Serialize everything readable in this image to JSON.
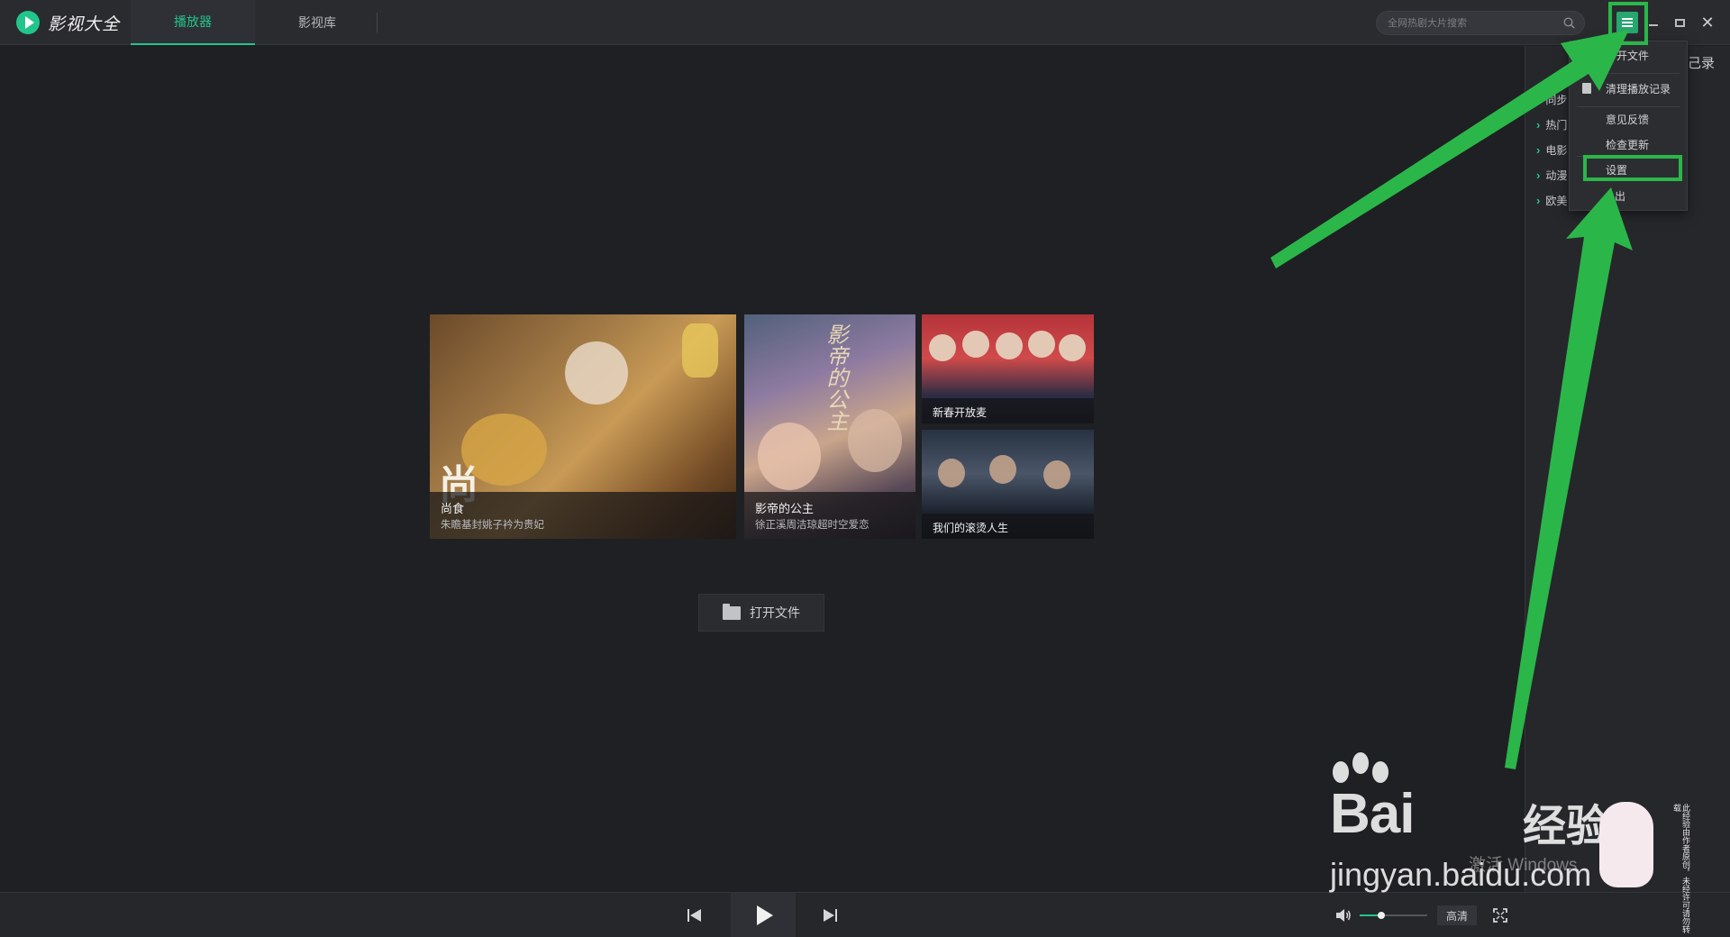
{
  "app": {
    "name": "影视大全",
    "tabs": [
      {
        "label": "播放器",
        "active": true
      },
      {
        "label": "影视库",
        "active": false
      }
    ],
    "search_placeholder": "全网热剧大片搜索"
  },
  "window_controls": {
    "menu": "menu-icon",
    "minimize": "minimize-icon",
    "maximize": "maximize-icon",
    "close": "✕"
  },
  "dropdown_menu": {
    "items": [
      {
        "label": "打开文件"
      },
      {
        "label": "清理播放记录"
      },
      {
        "label": "意见反馈"
      },
      {
        "label": "检查更新"
      },
      {
        "label": "设置"
      },
      {
        "label": "出"
      }
    ]
  },
  "right_panel": {
    "record_label": "己录",
    "categories": [
      {
        "label": "同步"
      },
      {
        "label": "热门"
      },
      {
        "label": "电影"
      },
      {
        "label": "动漫"
      },
      {
        "label": "欧美"
      }
    ]
  },
  "featured": [
    {
      "title": "尚食",
      "subtitle": "朱瞻基封姚子衿为贵妃",
      "poster_text": "尚"
    },
    {
      "title": "影帝的公主",
      "subtitle": "徐正溪周洁琼超时空爱恋",
      "poster_text": "影帝的公主"
    },
    {
      "title": "新春开放麦",
      "subtitle": ""
    },
    {
      "title": "我们的滚烫人生",
      "subtitle": ""
    }
  ],
  "open_file_label": "打开文件",
  "player": {
    "prev": "prev-icon",
    "play": "play-icon",
    "next": "next-icon",
    "volume_level": 0.32,
    "quality_label": "高清",
    "fullscreen": "fullscreen-icon"
  },
  "watermark": {
    "brand": "Bai",
    "brand_suffix": "经验",
    "url": "jingyan.baidu.com",
    "activate": "激活 Windows",
    "side_text": "此经验由作者原创，未经许可请勿转载"
  },
  "colors": {
    "accent": "#22c58b",
    "annotation": "#2bb64a",
    "background": "#1f2023",
    "topbar": "#2a2b2f"
  }
}
